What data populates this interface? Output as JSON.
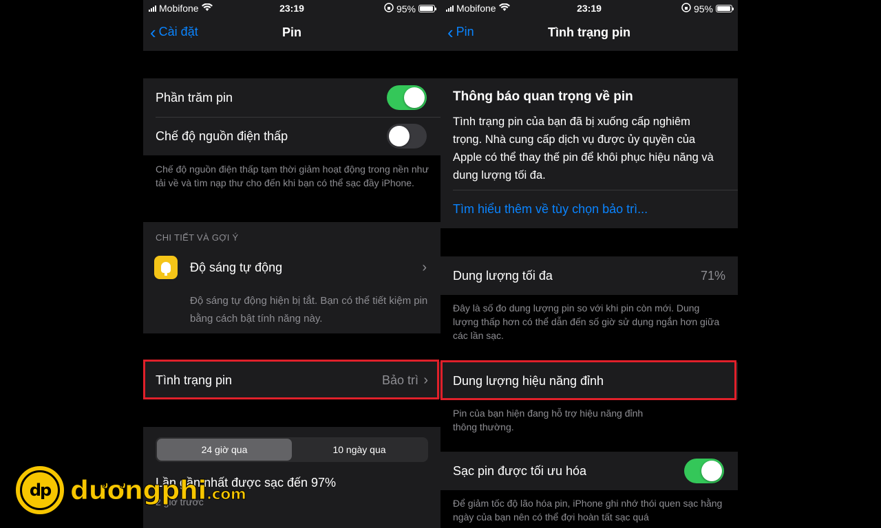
{
  "status_bar": {
    "carrier": "Mobifone",
    "time": "23:19",
    "battery_percent": "95%"
  },
  "left_screen": {
    "nav": {
      "back_label": "Cài đặt",
      "title": "Pin"
    },
    "battery_percentage": {
      "label": "Phần trăm pin",
      "enabled": true
    },
    "low_power_mode": {
      "label": "Chế độ nguồn điện thấp",
      "enabled": false
    },
    "low_power_footnote": "Chế độ nguồn điện thấp tạm thời giảm hoạt động trong nền như tải về và tìm nạp thư cho đến khi bạn có thể sạc đầy iPhone.",
    "insights": {
      "header": "CHI TIẾT VÀ GỢI Ý",
      "auto_brightness_label": "Độ sáng tự động",
      "auto_brightness_desc": "Độ sáng tự động hiện bị tắt. Bạn có thể tiết kiệm pin bằng cách bật tính năng này."
    },
    "battery_health": {
      "label": "Tình trạng pin",
      "value": "Bảo trì"
    },
    "usage": {
      "segments": [
        "24 giờ qua",
        "10 ngày qua"
      ],
      "active_segment": 0,
      "last_charged": "Lần gần nhất được sạc đến 97%",
      "last_charged_time": "2 giờ trước"
    }
  },
  "right_screen": {
    "nav": {
      "back_label": "Pin",
      "title": "Tình trạng pin"
    },
    "notice": {
      "title": "Thông báo quan trọng về pin",
      "body": "Tình trạng pin của bạn đã bị xuống cấp nghiêm trọng. Nhà cung cấp dịch vụ được ủy quyền của Apple có thể thay thế pin để khôi phục hiệu năng và dung lượng tối đa.",
      "link": "Tìm hiểu thêm về tùy chọn bảo trì..."
    },
    "max_capacity": {
      "label": "Dung lượng tối đa",
      "value": "71%"
    },
    "max_capacity_footnote": "Đây là số đo dung lượng pin so với khi pin còn mới. Dung lượng thấp hơn có thể dẫn đến số giờ sử dụng ngắn hơn giữa các lần sạc.",
    "peak_performance": {
      "label": "Dung lượng hiệu năng đỉnh"
    },
    "peak_performance_footnote": "Pin của bạn hiện đang hỗ trợ hiệu năng đỉnh thông thường.",
    "optimized_charging": {
      "label": "Sạc pin được tối ưu hóa",
      "enabled": true
    },
    "optimized_charging_footnote": "Để giảm tốc độ lão hóa pin, iPhone ghi nhớ thói quen sạc hằng ngày của bạn nên có thể đợi hoàn tất sạc quá"
  },
  "watermark": {
    "logo_mark": "dp",
    "brand": "dươngphi",
    "tld": ".com"
  },
  "colors": {
    "accent_blue": "#0a84ff",
    "toggle_on": "#34c759",
    "highlight_red": "#e0202a",
    "brand_yellow": "#f7c600"
  }
}
